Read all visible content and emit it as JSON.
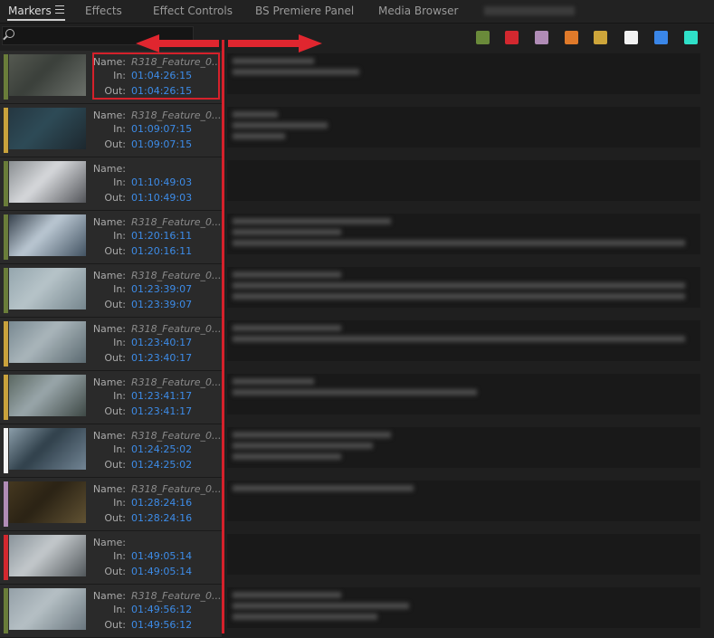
{
  "tabs": [
    {
      "label": "Markers",
      "active": true
    },
    {
      "label": "Effects"
    },
    {
      "label": "Effect Controls"
    },
    {
      "label": "BS Premiere Panel"
    },
    {
      "label": "Media Browser"
    }
  ],
  "search": {
    "placeholder": ""
  },
  "color_filters": [
    "#6a8a3a",
    "#d3282f",
    "#b08cb6",
    "#e07a2a",
    "#cda53a",
    "#f2f2f2",
    "#3a86e8",
    "#2fe0c8"
  ],
  "labels": {
    "name": "Name:",
    "in": "In:",
    "out": "Out:"
  },
  "markers": [
    {
      "color": "#6a7d3a",
      "name": "R318_Feature_0...",
      "in": "01:04:26:15",
      "out": "01:04:26:15",
      "comment_lines": 2,
      "thumb": [
        "#5a5e55",
        "#3a3f3a",
        "#737872"
      ]
    },
    {
      "color": "#c9a23c",
      "name": "R318_Feature_0...",
      "in": "01:09:07:15",
      "out": "01:09:07:15",
      "comment_lines": 3,
      "thumb": [
        "#23333d",
        "#2e4b57",
        "#1a2228"
      ]
    },
    {
      "color": "#6a7d3a",
      "name": "",
      "in": "01:10:49:03",
      "out": "01:10:49:03",
      "comment_lines": 0,
      "thumb": [
        "#7a7f82",
        "#d7d9dc",
        "#3d3f44"
      ]
    },
    {
      "color": "#6a7d3a",
      "name": "R318_Feature_0...",
      "in": "01:20:16:11",
      "out": "01:20:16:11",
      "comment_lines": 3,
      "thumb": [
        "#1b2530",
        "#bcc9d4",
        "#2f4050"
      ]
    },
    {
      "color": "#6a7d3a",
      "name": "R318_Feature_0...",
      "in": "01:23:39:07",
      "out": "01:23:39:07",
      "comment_lines": 3,
      "thumb": [
        "#8ea0a8",
        "#b7c4c9",
        "#6b7c84"
      ]
    },
    {
      "color": "#c9a23c",
      "name": "R318_Feature_0...",
      "in": "01:23:40:17",
      "out": "01:23:40:17",
      "comment_lines": 2,
      "thumb": [
        "#6f8089",
        "#aab6bb",
        "#4e5d64"
      ]
    },
    {
      "color": "#c9a23c",
      "name": "R318_Feature_0...",
      "in": "01:23:41:17",
      "out": "01:23:41:17",
      "comment_lines": 2,
      "thumb": [
        "#4d5a52",
        "#9aa7ab",
        "#2f3935"
      ]
    },
    {
      "color": "#f2f2f2",
      "name": "R318_Feature_0...",
      "in": "01:24:25:02",
      "out": "01:24:25:02",
      "comment_lines": 3,
      "thumb": [
        "#9eb1bd",
        "#2f3f4a",
        "#7d90a0"
      ]
    },
    {
      "color": "#b08cb6",
      "name": "R318_Feature_0...",
      "in": "01:28:24:16",
      "out": "01:28:24:16",
      "comment_lines": 1,
      "thumb": [
        "#4a3c22",
        "#2a2214",
        "#6a5a38"
      ]
    },
    {
      "color": "#d3282f",
      "name": "",
      "in": "01:49:05:14",
      "out": "01:49:05:14",
      "comment_lines": 0,
      "thumb": [
        "#7e8991",
        "#c4c9cc",
        "#3e4448"
      ]
    },
    {
      "color": "#6a7d3a",
      "name": "R318_Feature_0...",
      "in": "01:49:56:12",
      "out": "01:49:56:12",
      "comment_lines": 3,
      "thumb": [
        "#8e9aa2",
        "#b6c0c5",
        "#5d6a72"
      ]
    }
  ]
}
